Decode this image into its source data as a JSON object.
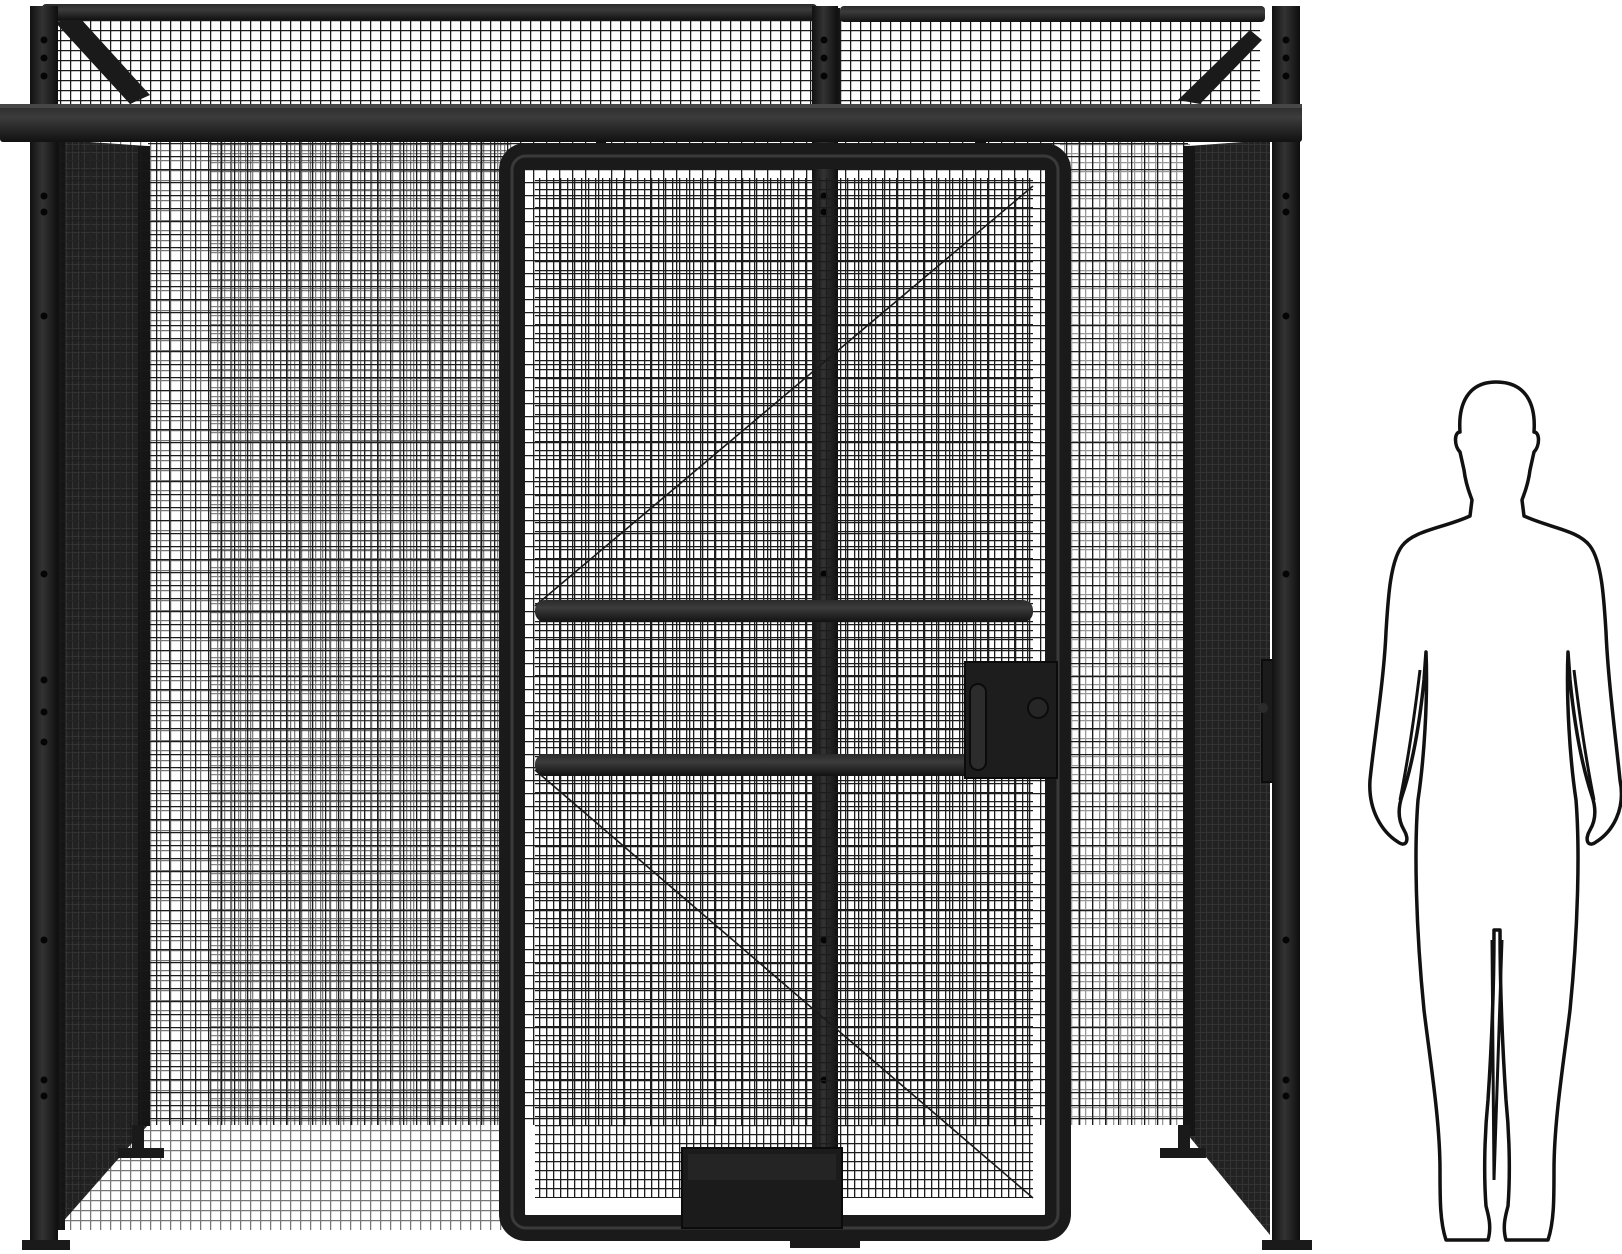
{
  "image": {
    "subject": "wire-mesh-cage-with-door-and-human-silhouette",
    "colors": {
      "background": "#ffffff",
      "frame": "#1a1a1a",
      "frame_highlight": "#3a3a3a",
      "mesh": "#1c1c1c",
      "silhouette_fill": "#ffffff",
      "silhouette_stroke": "#111111"
    }
  }
}
